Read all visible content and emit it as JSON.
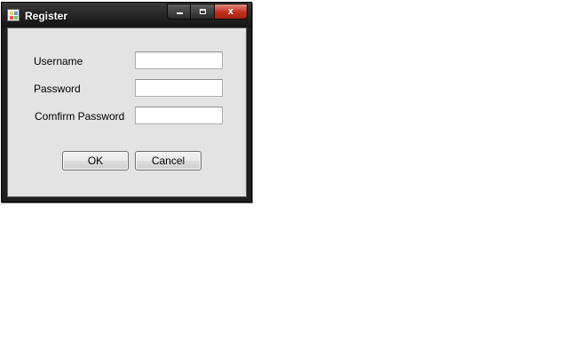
{
  "window": {
    "title": "Register",
    "app_icon": "form-app-icon",
    "minimize_icon": "minimize-icon",
    "maximize_icon": "maximize-icon",
    "close_icon": "close-icon",
    "close_glyph": "x"
  },
  "form": {
    "username_label": "Username",
    "username_value": "",
    "password_label": "Password",
    "password_value": "",
    "confirm_label": "Comfirm Password",
    "confirm_value": "",
    "ok_label": "OK",
    "cancel_label": "Cancel"
  },
  "colors": {
    "titlebar": "#1e1e1e",
    "client_background": "#e3e3e3",
    "close_button": "#c1301c"
  }
}
